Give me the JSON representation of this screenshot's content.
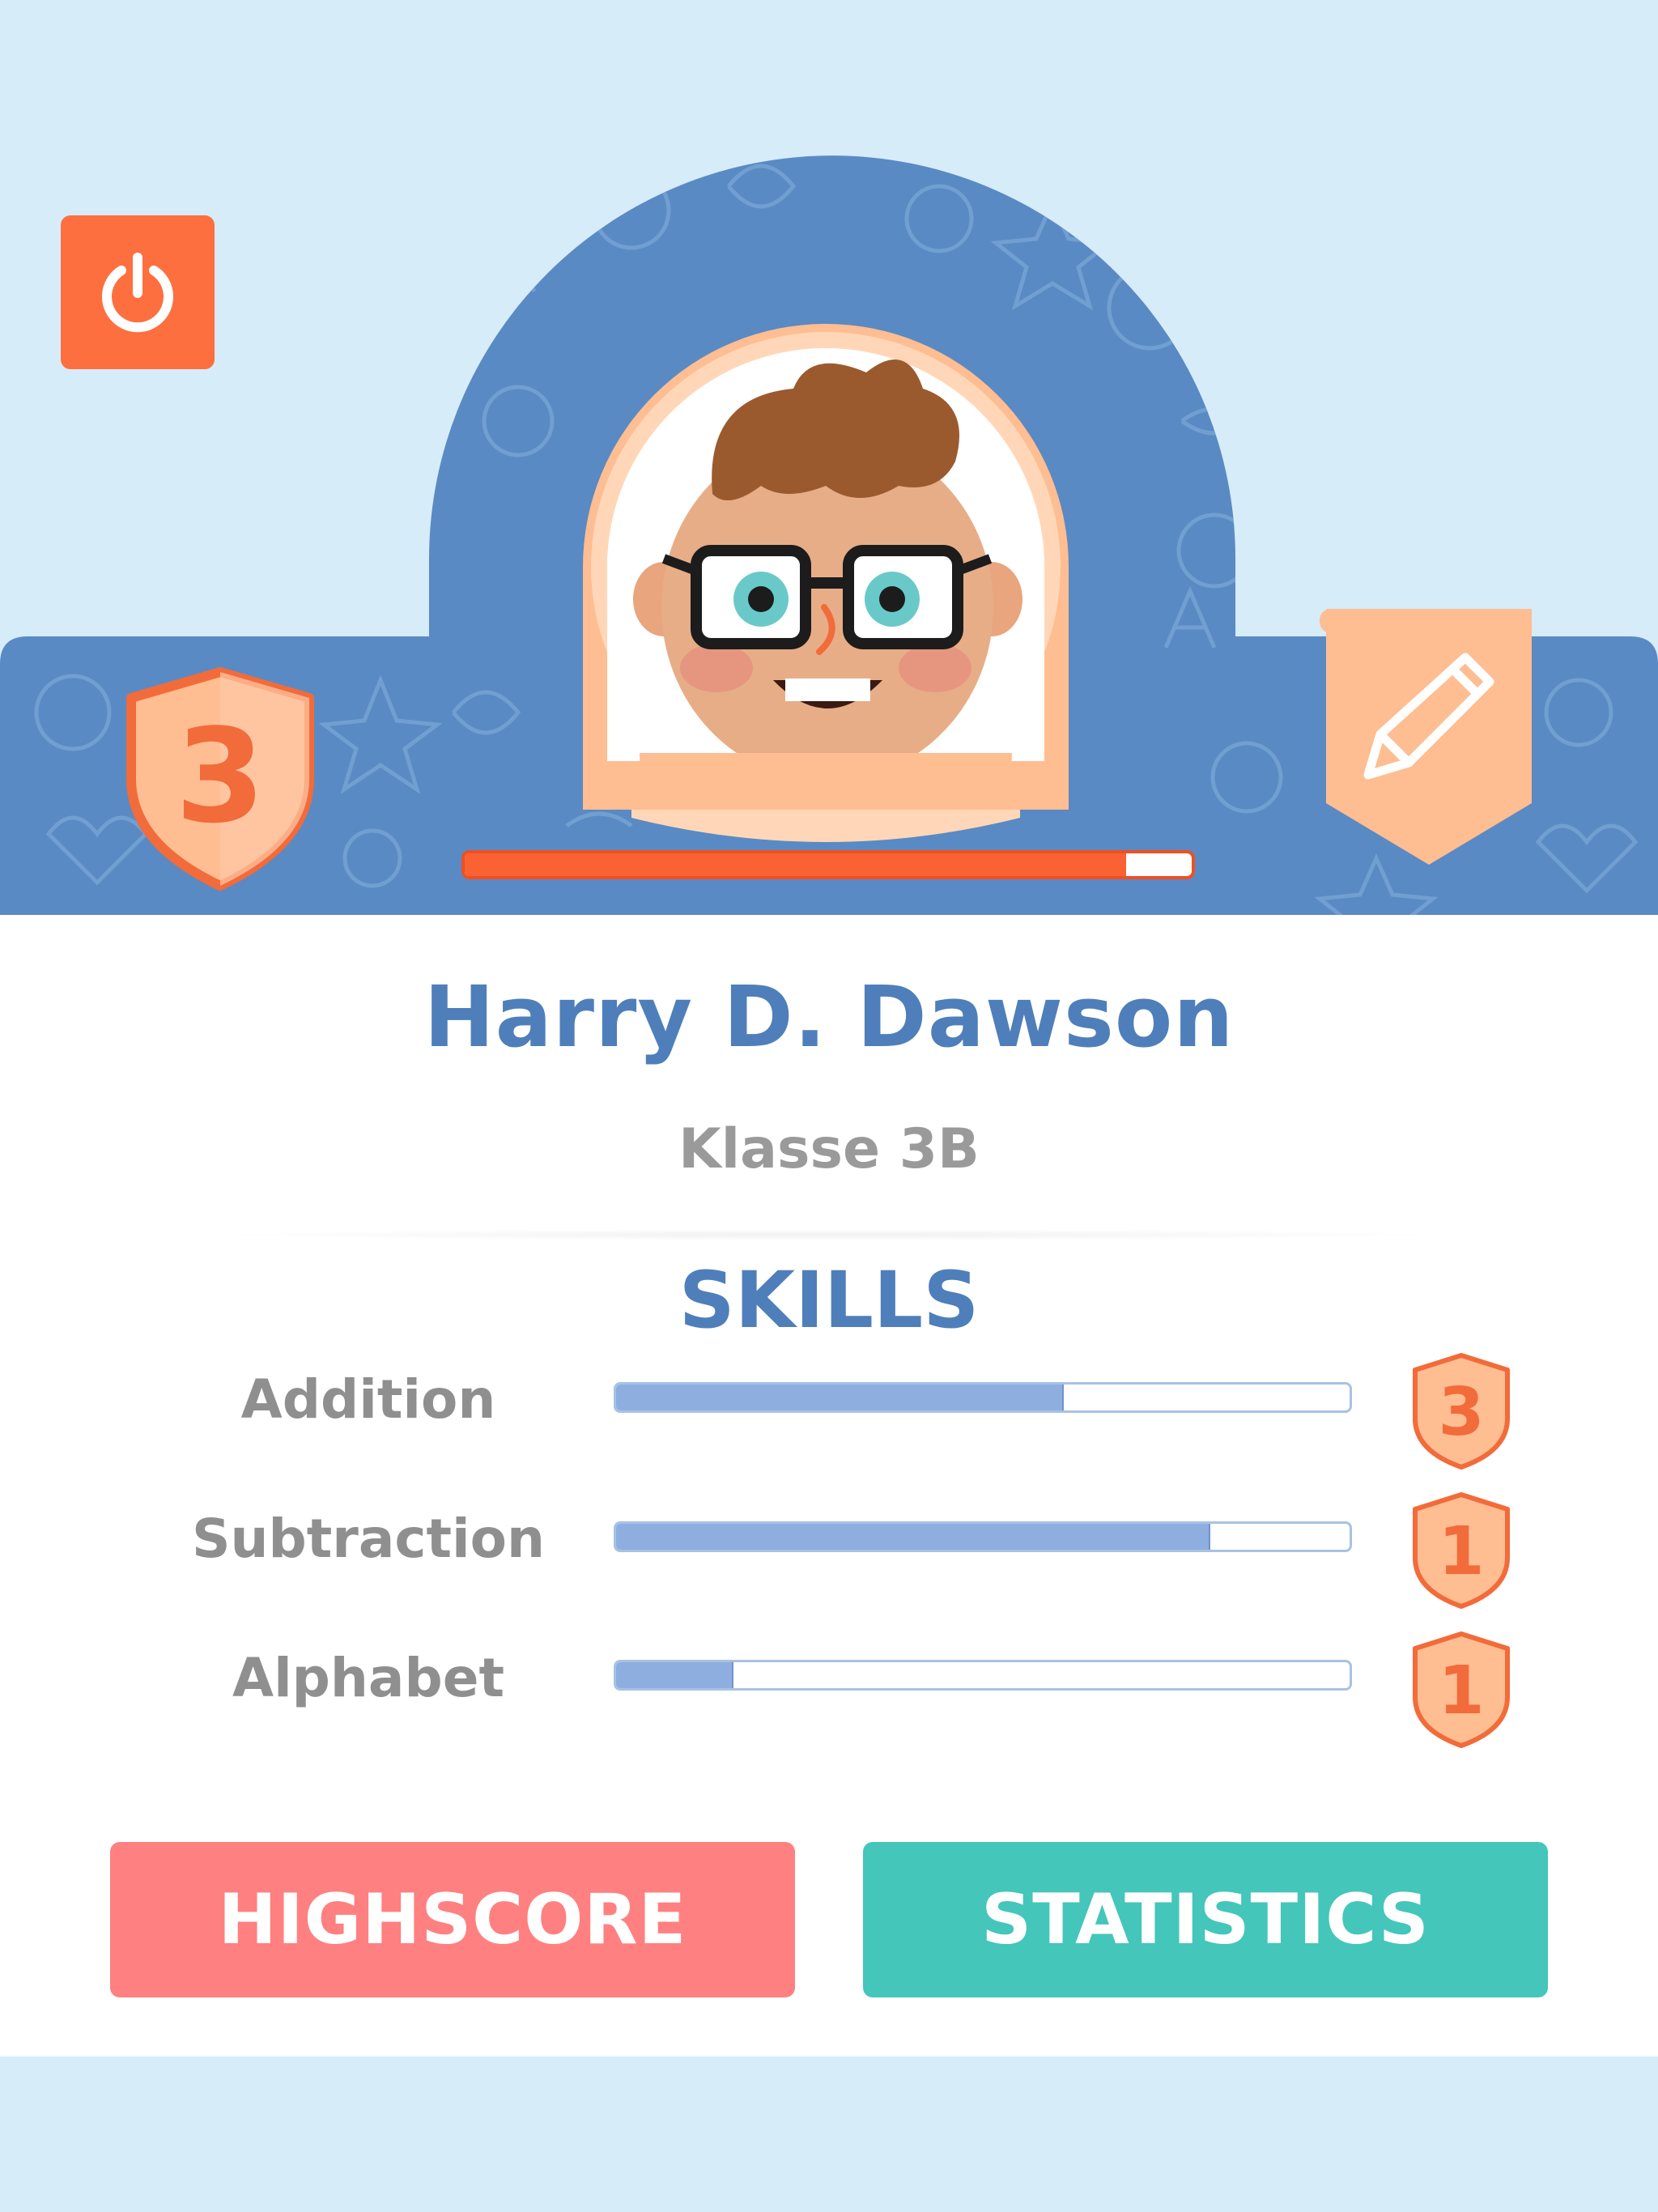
{
  "header": {
    "level": "3",
    "xp_progress": 0.91,
    "power_icon": "power-icon",
    "edit_icon": "pencil-icon"
  },
  "student": {
    "name": "Harry D. Dawson",
    "class": "Klasse 3B"
  },
  "skills": {
    "title": "SKILLS",
    "items": [
      {
        "label": "Addition",
        "progress": 0.61,
        "level": "3"
      },
      {
        "label": "Subtraction",
        "progress": 0.81,
        "level": "1"
      },
      {
        "label": "Alphabet",
        "progress": 0.16,
        "level": "1"
      }
    ]
  },
  "buttons": {
    "highscore": "HIGHSCORE",
    "statistics": "STATISTICS"
  },
  "colors": {
    "background": "#d6ecf9",
    "pattern_blue": "#5a8ac3",
    "accent_orange": "#fe6f3f",
    "badge_peach": "#ffbd92",
    "title_blue": "#4f7fba",
    "highscore_button": "#ff8080",
    "statistics_button": "#44c6ba"
  }
}
